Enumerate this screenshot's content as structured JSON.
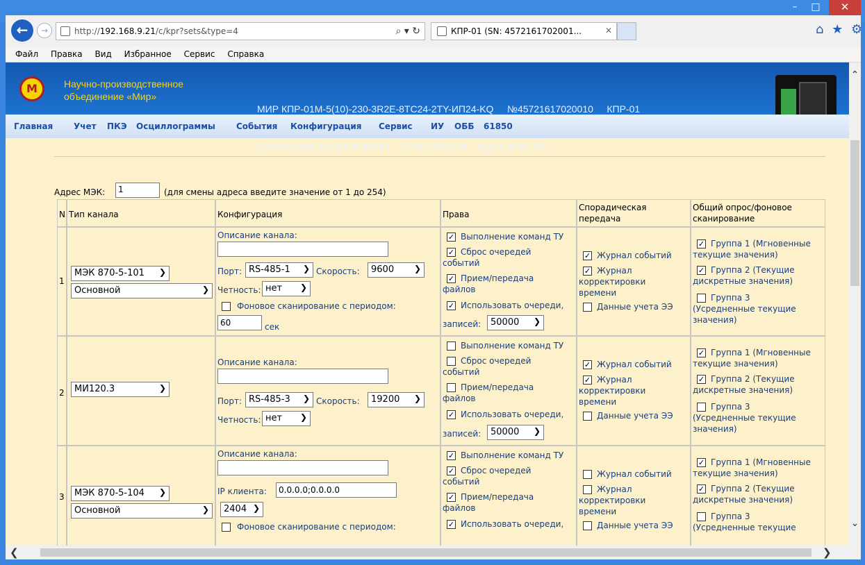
{
  "window": {
    "min": "–",
    "max": "□",
    "close": "✕"
  },
  "browser": {
    "url_prefix": "http://",
    "url_host": "192.168.9.21",
    "url_path": "/c/kpr?sets&type=4",
    "addr_controls": "⌕ ▾ ↻",
    "tab_title": "КПР-01 (SN: 4572161702001...",
    "tab_close": "✕",
    "icons": [
      "home-icon",
      "star-icon",
      "gear-icon"
    ]
  },
  "menu": [
    "Файл",
    "Правка",
    "Вид",
    "Избранное",
    "Сервис",
    "Справка"
  ],
  "header": {
    "org_line1": "Научно-производственное",
    "org_line2": "объединение «Мир»",
    "dev_line1": "МИР КПР-01М-5(10)-230-3R2E-8TC24-2TY-ИП24-KQ     №45721617020010     КПР-01",
    "dev_line2": "Сетевое имя: kpr-01-4040010   IP: 192.168.9.21   Адрес МЭК: 001",
    "logo": "M"
  },
  "nav": [
    "Главная",
    "Учет",
    "ПКЭ",
    "Осциллограммы",
    "События",
    "Конфигурация",
    "Сервис",
    "ИУ",
    "ОББ",
    "61850"
  ],
  "form": {
    "mek_label": "Адрес МЭК:",
    "mek_value": "1",
    "mek_hint": "(для смены адреса введите значение от 1 до 254)"
  },
  "table": {
    "headers": {
      "n": "N",
      "type": "Тип канала",
      "config": "Конфигурация",
      "rights": "Права",
      "spor1": "Спорадическая",
      "spor2": "передача",
      "poll1": "Общий опрос/фоновое",
      "poll2": "сканирование"
    },
    "labels": {
      "desc": "Описание канала:",
      "port": "Порт:",
      "speed": "Скорость:",
      "parity": "Четность:",
      "bg_scan": "Фоновое сканирование с периодом:",
      "sec": "сек",
      "ip_client": "IP клиента:",
      "r1": "Выполнение команд ТУ",
      "r2a": "Сброс очередей",
      "r2b": "событий",
      "r3a": "Прием/передача",
      "r3b": "файлов",
      "r4": "Использовать очереди,",
      "r5": "записей:",
      "s1": "Журнал событий",
      "s2a": "Журнал",
      "s2b": "корректировки",
      "s2c": "времени",
      "s3": "Данные учета ЭЭ",
      "g1a": "Группа 1 (Мгновенные",
      "g1b": "текущие значения)",
      "g2a": "Группа 2 (Текущие",
      "g2b": "дискретные значения)",
      "g3a": "Группа 3",
      "g3b": "(Усредненные текущие",
      "g3c": "значения)"
    },
    "rows": [
      {
        "n": "1",
        "protocol": "МЭК 870-5-101",
        "mode": "Основной",
        "port": "RS-485-1",
        "speed": "9600",
        "parity": "нет",
        "period": "60",
        "queue": "50000",
        "check_r1": "✓",
        "check_r2": "✓",
        "check_r3": "✓",
        "check_r4": "✓",
        "check_s1": "✓",
        "check_s2": "✓",
        "check_s3": "",
        "check_g1": "✓",
        "check_g2": "✓",
        "check_g3": "",
        "check_bg": ""
      },
      {
        "n": "2",
        "protocol": "МИ120.3",
        "port": "RS-485-3",
        "speed": "19200",
        "parity": "нет",
        "queue": "50000",
        "check_r1": "",
        "check_r2": "",
        "check_r3": "",
        "check_r4": "✓",
        "check_s1": "✓",
        "check_s2": "✓",
        "check_s3": "",
        "check_g1": "✓",
        "check_g2": "✓",
        "check_g3": ""
      },
      {
        "n": "3",
        "protocol": "МЭК 870-5-104",
        "mode": "Основной",
        "ip": "0.0.0.0;0.0.0.0",
        "tcp_port": "2404",
        "check_r1": "✓",
        "check_r2": "✓",
        "check_r3": "✓",
        "check_r4": "✓",
        "check_s1": "",
        "check_s2": "",
        "check_s3": "",
        "check_g1": "✓",
        "check_g2": "✓",
        "check_g3": "",
        "check_bg": ""
      }
    ]
  }
}
